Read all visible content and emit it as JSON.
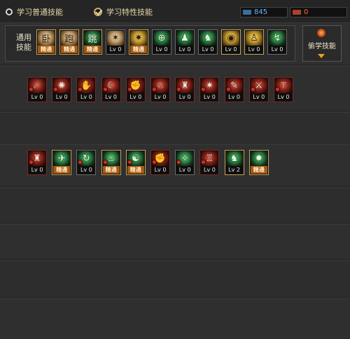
{
  "header": {
    "tab_normal": "学习普通技能",
    "tab_trait": "学习特性技能",
    "blue_counter": "845",
    "red_counter": "0"
  },
  "general": {
    "label": "通用\n技能",
    "skills": [
      {
        "label": "精通",
        "style": "beige",
        "glyph": "卧"
      },
      {
        "label": "精通",
        "style": "beige",
        "glyph": "跑"
      },
      {
        "label": "精通",
        "style": "green",
        "glyph": "跳"
      },
      {
        "label": "Lv 0",
        "style": "beige",
        "glyph": "✶"
      },
      {
        "label": "精通",
        "style": "gold",
        "glyph": "✷"
      },
      {
        "label": "Lv 0",
        "style": "green",
        "glyph": "⊕"
      },
      {
        "label": "Lv 0",
        "style": "green",
        "glyph": "♟"
      },
      {
        "label": "Lv 0",
        "style": "green",
        "glyph": "♞"
      },
      {
        "label": "Lv 0",
        "style": "gold",
        "glyph": "◉"
      },
      {
        "label": "Lv 0",
        "style": "gold",
        "glyph": "♙"
      },
      {
        "label": "Lv 0",
        "style": "green",
        "glyph": "↯"
      }
    ]
  },
  "steal": {
    "label": "偷学技能"
  },
  "row2": {
    "skills": [
      {
        "label": "Lv 0",
        "style": "red",
        "glyph": "☄",
        "lock": true
      },
      {
        "label": "Lv 0",
        "style": "red",
        "glyph": "✺",
        "lock": true
      },
      {
        "label": "Lv 0",
        "style": "red",
        "glyph": "✋",
        "lock": true
      },
      {
        "label": "Lv 0",
        "style": "red",
        "glyph": "☾",
        "lock": true
      },
      {
        "label": "Lv 0",
        "style": "red",
        "glyph": "✊",
        "lock": true
      },
      {
        "label": "Lv 0",
        "style": "red",
        "glyph": "♘",
        "lock": true
      },
      {
        "label": "Lv 0",
        "style": "red",
        "glyph": "♜",
        "lock": true
      },
      {
        "label": "Lv 0",
        "style": "red",
        "glyph": "✷",
        "lock": true
      },
      {
        "label": "Lv 0",
        "style": "red",
        "glyph": "✎",
        "lock": true
      },
      {
        "label": "Lv 0",
        "style": "red",
        "glyph": "⚔",
        "lock": true
      },
      {
        "label": "Lv 0",
        "style": "red",
        "glyph": "⚚",
        "lock": true
      }
    ]
  },
  "row3": {
    "skills": [
      {
        "label": "Lv 0",
        "style": "red",
        "glyph": "♜",
        "lock": true,
        "frame": "red"
      },
      {
        "label": "精通",
        "style": "green",
        "glyph": "✈",
        "lock": false,
        "frame": "gold"
      },
      {
        "label": "Lv 0",
        "style": "green",
        "glyph": "↻",
        "lock": true,
        "frame": "gray"
      },
      {
        "label": "精通",
        "style": "green",
        "glyph": "♨",
        "lock": true,
        "frame": "gold"
      },
      {
        "label": "精通",
        "style": "green",
        "glyph": "☯",
        "lock": true,
        "frame": "gold"
      },
      {
        "label": "Lv 0",
        "style": "red",
        "glyph": "✊",
        "lock": true,
        "frame": "red"
      },
      {
        "label": "Lv 0",
        "style": "green",
        "glyph": "✧",
        "lock": true,
        "frame": "gray"
      },
      {
        "label": "Lv 0",
        "style": "red",
        "glyph": "♖",
        "lock": true,
        "frame": "red"
      },
      {
        "label": "Lv 2",
        "style": "green",
        "glyph": "♞",
        "lock": false,
        "frame": "gold"
      },
      {
        "label": "精通",
        "style": "green",
        "glyph": "✹",
        "lock": false,
        "frame": "gold"
      }
    ]
  }
}
